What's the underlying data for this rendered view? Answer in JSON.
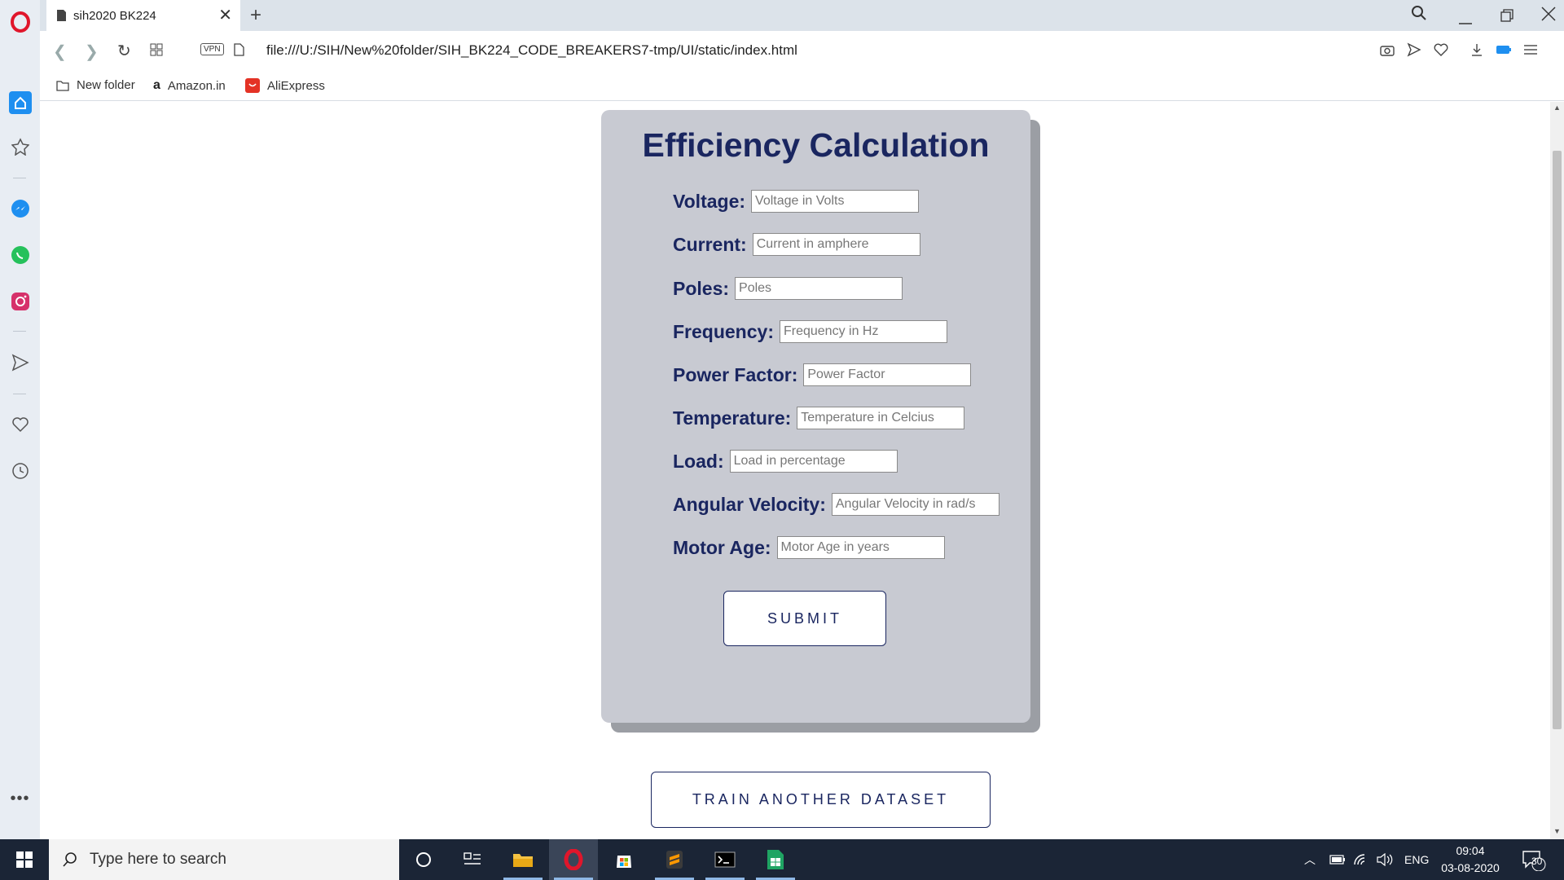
{
  "browser": {
    "tab_title": "sih2020 BK224",
    "url": "file:///U:/SIH/New%20folder/SIH_BK224_CODE_BREAKERS7-tmp/UI/static/index.html",
    "vpn_label": "VPN",
    "bookmarks": [
      {
        "label": "New folder",
        "icon": "folder-icon"
      },
      {
        "label": "Amazon.in",
        "icon": "amazon-icon"
      },
      {
        "label": "AliExpress",
        "icon": "aliexpress-icon"
      }
    ]
  },
  "form": {
    "title": "Efficiency Calculation",
    "fields": [
      {
        "label": "Voltage:",
        "placeholder": "Voltage in Volts"
      },
      {
        "label": "Current:",
        "placeholder": "Current in amphere"
      },
      {
        "label": "Poles:",
        "placeholder": "Poles"
      },
      {
        "label": "Frequency:",
        "placeholder": "Frequency in Hz"
      },
      {
        "label": "Power Factor:",
        "placeholder": "Power Factor"
      },
      {
        "label": "Temperature:",
        "placeholder": "Temperature in Celcius"
      },
      {
        "label": "Load:",
        "placeholder": "Load in percentage"
      },
      {
        "label": "Angular Velocity:",
        "placeholder": "Angular Velocity in rad/s"
      },
      {
        "label": "Motor Age:",
        "placeholder": "Motor Age in years"
      }
    ],
    "submit_label": "SUBMIT"
  },
  "train_button_label": "TRAIN ANOTHER DATASET",
  "taskbar": {
    "search_placeholder": "Type here to search",
    "language": "ENG",
    "time": "09:04",
    "date": "03-08-2020",
    "notification_count": "30"
  },
  "colors": {
    "accent": "#1a2660",
    "card": "#c8cad2",
    "taskbar": "#1b2536"
  }
}
